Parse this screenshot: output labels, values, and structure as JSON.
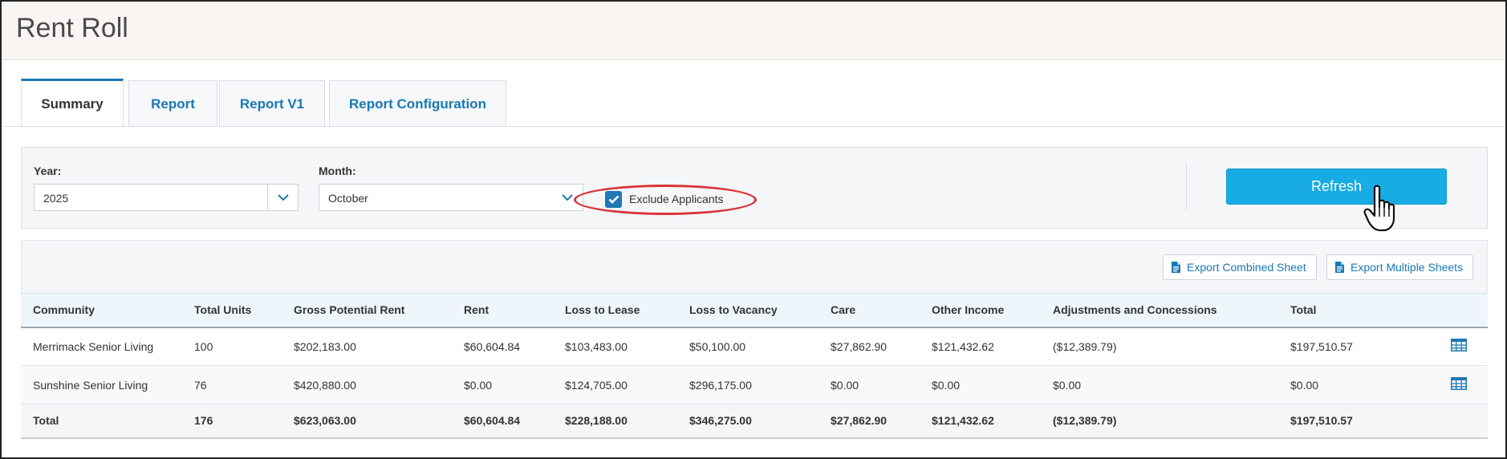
{
  "page": {
    "title": "Rent Roll"
  },
  "tabs": [
    {
      "label": "Summary",
      "active": true
    },
    {
      "label": "Report",
      "active": false
    },
    {
      "label": "Report V1",
      "active": false
    },
    {
      "label": "Report Configuration",
      "active": false
    }
  ],
  "filters": {
    "year_label": "Year:",
    "year_value": "2025",
    "month_label": "Month:",
    "month_value": "October",
    "exclude_applicants_label": "Exclude Applicants",
    "exclude_applicants_checked": true,
    "refresh_label": "Refresh"
  },
  "toolbar": {
    "export_combined_label": "Export Combined Sheet",
    "export_multiple_label": "Export Multiple Sheets"
  },
  "table": {
    "columns": [
      "Community",
      "Total Units",
      "Gross Potential Rent",
      "Rent",
      "Loss to Lease",
      "Loss to Vacancy",
      "Care",
      "Other Income",
      "Adjustments and Concessions",
      "Total"
    ],
    "rows": [
      [
        "Merrimack Senior Living",
        "100",
        "$202,183.00",
        "$60,604.84",
        "$103,483.00",
        "$50,100.00",
        "$27,862.90",
        "$121,432.62",
        "($12,389.79)",
        "$197,510.57"
      ],
      [
        "Sunshine Senior Living",
        "76",
        "$420,880.00",
        "$0.00",
        "$124,705.00",
        "$296,175.00",
        "$0.00",
        "$0.00",
        "$0.00",
        "$0.00"
      ]
    ],
    "totals": [
      "Total",
      "176",
      "$623,063.00",
      "$60,604.84",
      "$228,188.00",
      "$346,275.00",
      "$27,862.90",
      "$121,432.62",
      "($12,389.79)",
      "$197,510.57"
    ]
  },
  "colors": {
    "accent": "#1978b4",
    "refresh_button": "#19abe4",
    "highlight": "#d9343a"
  },
  "icons": {
    "caret": "chevron-down-icon",
    "export": "document-icon",
    "row_action": "table-grid-icon",
    "cursor": "hand-pointer-icon"
  }
}
